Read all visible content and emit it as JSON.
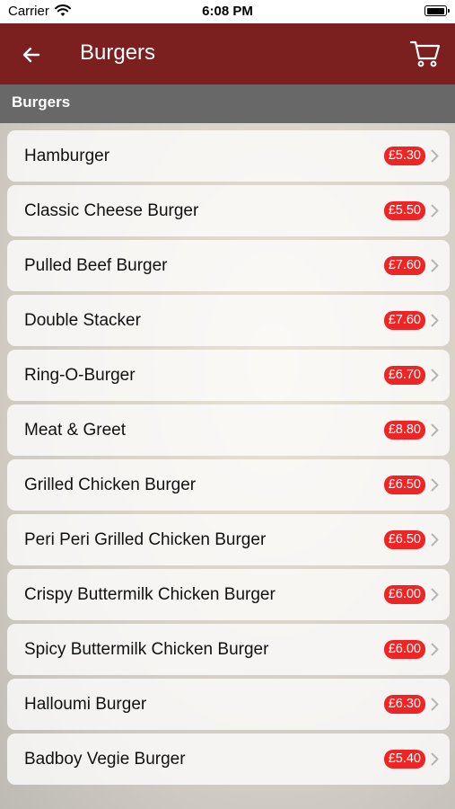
{
  "status_bar": {
    "carrier": "Carrier",
    "time": "6:08 PM"
  },
  "nav": {
    "title": "Burgers",
    "back_icon": "arrow-left-icon",
    "cart_icon": "cart-icon"
  },
  "section": {
    "title": "Burgers"
  },
  "colors": {
    "nav_bg": "#7b1f1f",
    "section_bg": "#686868",
    "price_badge": "#ef2525"
  },
  "items": [
    {
      "name": "Hamburger",
      "price": "£5.30"
    },
    {
      "name": "Classic Cheese Burger",
      "price": "£5.50"
    },
    {
      "name": "Pulled Beef Burger",
      "price": "£7.60"
    },
    {
      "name": "Double Stacker",
      "price": "£7.60"
    },
    {
      "name": "Ring-O-Burger",
      "price": "£6.70"
    },
    {
      "name": "Meat & Greet",
      "price": "£8.80"
    },
    {
      "name": "Grilled Chicken Burger",
      "price": "£6.50"
    },
    {
      "name": "Peri Peri Grilled Chicken Burger",
      "price": "£6.50"
    },
    {
      "name": "Crispy Buttermilk Chicken Burger",
      "price": "£6.00"
    },
    {
      "name": "Spicy Buttermilk Chicken Burger",
      "price": "£6.00"
    },
    {
      "name": "Halloumi Burger",
      "price": "£6.30"
    },
    {
      "name": "Badboy Vegie Burger",
      "price": "£5.40"
    }
  ]
}
